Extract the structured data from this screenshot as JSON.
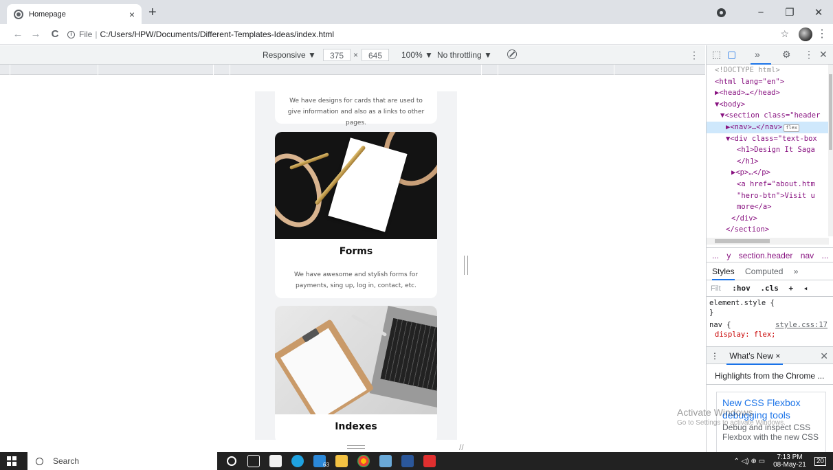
{
  "browser": {
    "tab_title": "Homepage",
    "tab_close": "×",
    "new_tab": "+",
    "window_controls": {
      "minimize": "−",
      "maximize": "❐",
      "close": "✕"
    },
    "nav": {
      "back": "←",
      "forward": "→",
      "reload": "C"
    },
    "address": {
      "scheme": "File",
      "separator": "|",
      "path": "C:/Users/HPW/Documents/Different-Templates-Ideas/index.html"
    },
    "star": "☆",
    "menu": "⋮"
  },
  "device_toolbar": {
    "mode": "Responsive ▼",
    "width": "375",
    "times": "×",
    "height": "645",
    "zoom": "100% ▼",
    "throttle": "No throttling ▼",
    "more": "⋮"
  },
  "page": {
    "top_card_text": "We have designs for cards that are used to give information and also as a links to other pages.",
    "cards": [
      {
        "title": "Forms",
        "text": "We have awesome and stylish forms for payments, sing up, log in, contact, etc."
      },
      {
        "title": "Indexes",
        "text": ""
      }
    ]
  },
  "devtools": {
    "toolbar": {
      "inspect": "⬚",
      "device": "▢",
      "more_panels": "»",
      "settings": "⚙",
      "menu": "⋮",
      "close": "✕"
    },
    "elements": [
      {
        "text": "<!DOCTYPE html>",
        "kind": "comment",
        "indent": 1
      },
      {
        "text": "<html lang=\"en\">",
        "kind": "tag",
        "indent": 1
      },
      {
        "text": "▶<head>…</head>",
        "kind": "tag",
        "indent": 1
      },
      {
        "text": "▼<body>",
        "kind": "tag",
        "indent": 1
      },
      {
        "text": "▼<section class=\"header",
        "kind": "tag",
        "indent": 2
      },
      {
        "text": "▶<nav>…</nav>",
        "kind": "tag",
        "indent": 3,
        "badge": "flex",
        "selected": true
      },
      {
        "text": "▼<div class=\"text-box",
        "kind": "tag",
        "indent": 3
      },
      {
        "text": "<h1>Design It Saga",
        "kind": "tag",
        "indent": 5
      },
      {
        "text": "</h1>",
        "kind": "tag",
        "indent": 5
      },
      {
        "text": "▶<p>…</p>",
        "kind": "tag",
        "indent": 4
      },
      {
        "text": "<a href=\"about.htm",
        "kind": "tag",
        "indent": 5
      },
      {
        "text": "\"hero-btn\">Visit u",
        "kind": "tag",
        "indent": 5
      },
      {
        "text": "more</a>",
        "kind": "tag",
        "indent": 5
      },
      {
        "text": "</div>",
        "kind": "tag",
        "indent": 4
      },
      {
        "text": "</section>",
        "kind": "tag",
        "indent": 3
      }
    ],
    "breadcrumbs": [
      "...",
      "y",
      "section.header",
      "nav",
      "..."
    ],
    "style_tabs": {
      "styles": "Styles",
      "computed": "Computed",
      "more": "»"
    },
    "filter": {
      "placeholder": "Filt",
      "hov": ":hov",
      "cls": ".cls",
      "plus": "+",
      "toggle": "◂"
    },
    "rules": {
      "element_style_open": "element.style {",
      "element_style_close": "}",
      "nav_selector": "nav {",
      "nav_source": "style.css:17",
      "nav_prop": "display: flex;"
    },
    "drawer": {
      "menu": "⋮",
      "tab": "What's New ×",
      "close": "✕"
    },
    "highlights": "Highlights from the Chrome ...",
    "news": {
      "title": "New CSS Flexbox debugging tools",
      "body": "Debug and inspect CSS Flexbox with the new CSS"
    }
  },
  "watermark": {
    "title": "Activate Windows",
    "subtitle": "Go to Settings to activate Windows."
  },
  "taskbar": {
    "search_placeholder": "Search",
    "clock_time": "7:13 PM",
    "clock_date": "08-May-21",
    "mail_badge": "63",
    "notif_badge": "20"
  },
  "colors": {
    "accent": "#1a73e8",
    "tab_strip": "#dee1e6",
    "taskbar": "#222222"
  }
}
